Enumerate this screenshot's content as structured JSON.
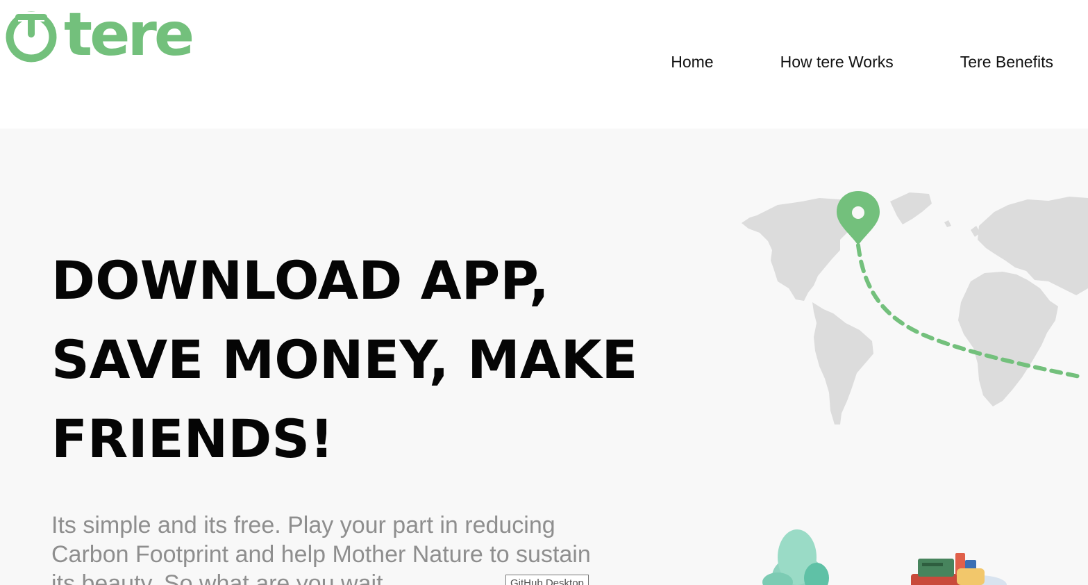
{
  "header": {
    "logo": {
      "text": "tere",
      "icon": "power-icon",
      "color": "#73c07c"
    },
    "nav": [
      {
        "label": "Home"
      },
      {
        "label": "How tere Works"
      },
      {
        "label": "Tere Benefits"
      }
    ]
  },
  "hero": {
    "headline_lines": [
      "DOWNLOAD APP,",
      "SAVE MONEY, MAKE",
      "FRIENDS!"
    ],
    "subtext": "Its simple and its free. Play your part in reducing Carbon Footprint and help Mother Nature to sustain its beauty. So what are you wait",
    "tooltip": "GitHub Desktop",
    "illustrations": [
      "world-map-image",
      "map-pin-icon",
      "tree-image",
      "luggage-image"
    ]
  },
  "colors": {
    "accent": "#73c07c",
    "hero_background": "#f8f8f8",
    "headline": "#050505",
    "subtext": "#8e8e8e",
    "map_land": "#dcdcdc"
  }
}
